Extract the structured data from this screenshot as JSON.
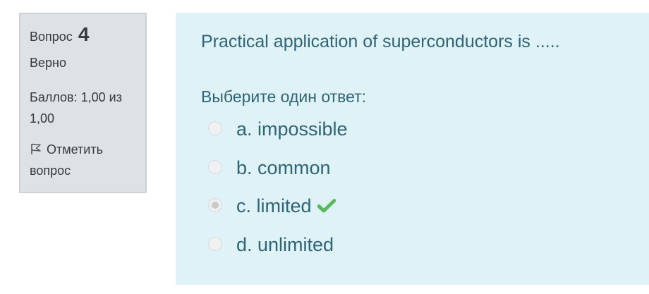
{
  "info": {
    "question_label": "Вопрос",
    "question_number": "4",
    "state": "Верно",
    "grade": "Баллов: 1,00 из 1,00",
    "flag_label": "Отметить вопрос",
    "flag_icon": "flag-outline-icon"
  },
  "question": {
    "text": "Practical application of superconductors is .....",
    "prompt": "Выберите один ответ:",
    "answers": [
      {
        "label": "a. impossible",
        "selected": false
      },
      {
        "label": "b. common",
        "selected": false
      },
      {
        "label": "c. limited",
        "selected": true,
        "correct": true
      },
      {
        "label": "d. unlimited",
        "selected": false
      }
    ],
    "correct_icon": "check-icon"
  },
  "colors": {
    "info_background": "#dee2e6",
    "content_background": "#def2f8",
    "content_text": "#2f6473",
    "check_green": "#5cb85c"
  }
}
